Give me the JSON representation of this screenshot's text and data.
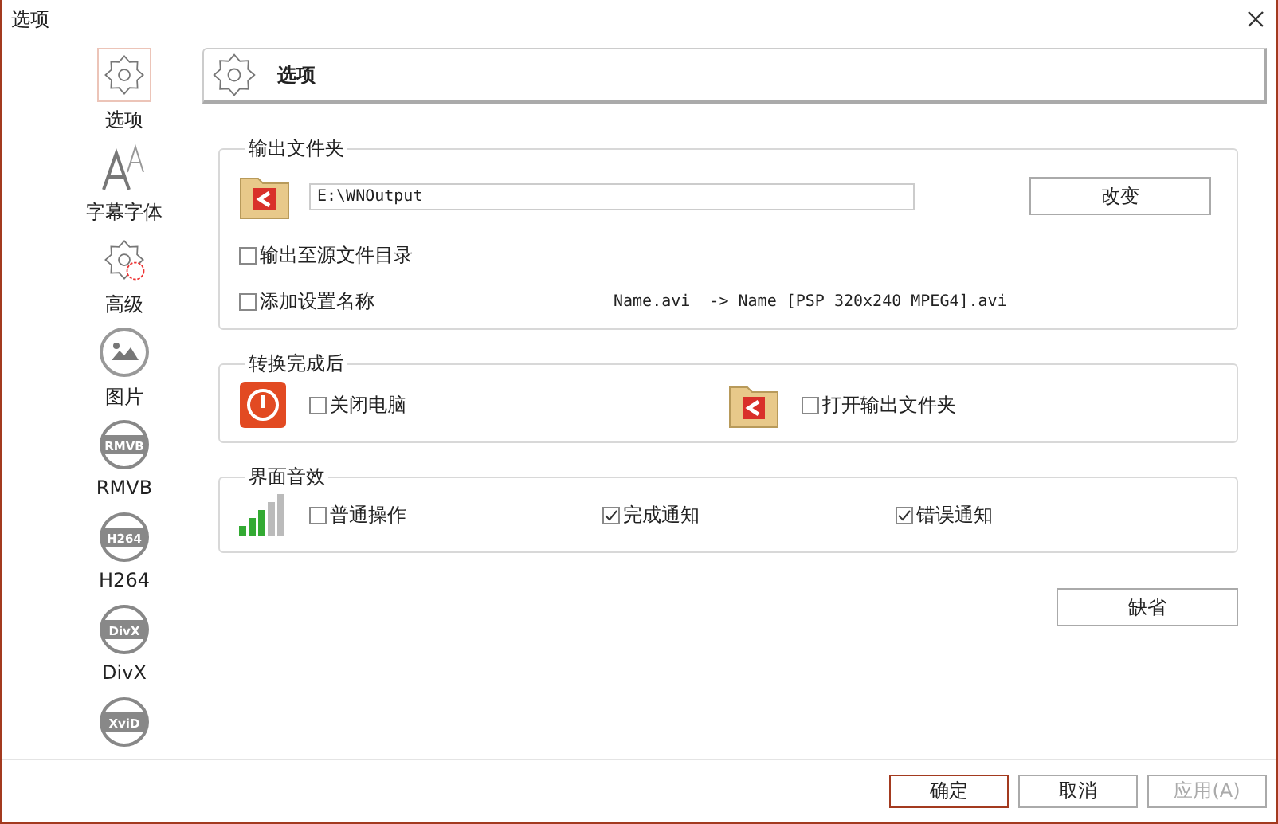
{
  "window": {
    "title": "选项"
  },
  "sidebar": {
    "items": [
      {
        "kind": "gear",
        "label": "选项",
        "selected": true
      },
      {
        "kind": "font",
        "label": "字幕字体",
        "selected": false
      },
      {
        "kind": "advanced",
        "label": "高级",
        "selected": false
      },
      {
        "kind": "picture",
        "label": "图片",
        "selected": false
      },
      {
        "kind": "badge",
        "badge": "RMVB",
        "label": "RMVB",
        "selected": false
      },
      {
        "kind": "badge",
        "badge": "H264",
        "label": "H264",
        "selected": false
      },
      {
        "kind": "badge",
        "badge": "DivX",
        "label": "DivX",
        "selected": false
      },
      {
        "kind": "badge",
        "badge": "XviD",
        "selected": false
      }
    ]
  },
  "header": {
    "title": "选项"
  },
  "output_folder": {
    "legend": "输出文件夹",
    "path": "E:\\WNOutput",
    "change_button": "改变",
    "options": [
      {
        "label": "输出至源文件目录",
        "checked": false
      },
      {
        "label": "添加设置名称",
        "checked": false,
        "example": "Name.avi  -> Name [PSP 320x240 MPEG4].avi"
      }
    ]
  },
  "after_conversion": {
    "legend": "转换完成后",
    "options": [
      {
        "kind": "power",
        "label": "关闭电脑",
        "checked": false
      },
      {
        "kind": "folder",
        "label": "打开输出文件夹",
        "checked": false
      }
    ]
  },
  "sound": {
    "legend": "界面音效",
    "options": [
      {
        "label": "普通操作",
        "checked": false
      },
      {
        "label": "完成通知",
        "checked": true
      },
      {
        "label": "错误通知",
        "checked": true
      }
    ]
  },
  "default_button": "缺省",
  "buttons": [
    {
      "label": "确定",
      "primary": true,
      "disabled": false
    },
    {
      "label": "取消",
      "primary": false,
      "disabled": false
    },
    {
      "label": "应用(A)",
      "primary": false,
      "disabled": true
    }
  ]
}
